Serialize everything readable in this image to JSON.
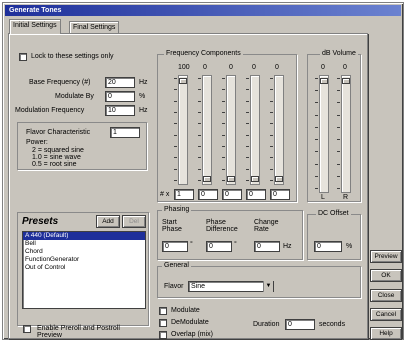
{
  "window": {
    "title": "Generate Tones"
  },
  "tabs": [
    {
      "label": "Initial Settings"
    },
    {
      "label": "Final Settings"
    }
  ],
  "options": {
    "lock_label": "Lock to these settings only"
  },
  "base": {
    "base_freq_label": "Base Frequency (#)",
    "base_freq_value": "20",
    "base_freq_unit": "Hz",
    "modulate_label": "Modulate By",
    "modulate_value": "0",
    "modulate_unit": "%",
    "modfreq_label": "Modulation Frequency",
    "modfreq_value": "10",
    "modfreq_unit": "Hz"
  },
  "flavor": {
    "label": "Flavor Characteristic",
    "value": "1",
    "power_label": "Power:",
    "line1": "2 = squared sine",
    "line2": "1.0 = sine wave",
    "line3": "0.5 = root sine"
  },
  "freq_components": {
    "title": "Frequency Components",
    "top_values": [
      "100",
      "0",
      "0",
      "0",
      "0"
    ],
    "field_label": "# x",
    "values": [
      "1",
      "0",
      "0",
      "0",
      "0"
    ],
    "levels": [
      1.0,
      0.0,
      0.0,
      0.0,
      0.0
    ]
  },
  "volume": {
    "title": "dB Volume",
    "top_values": [
      "0",
      "0"
    ],
    "left_label": "L",
    "right_label": "R",
    "levels": [
      1.0,
      1.0
    ]
  },
  "phasing": {
    "title": "Phasing",
    "start_label_1": "Start",
    "start_label_2": "Phase",
    "start_value": "0",
    "start_unit": "°",
    "diff_label_1": "Phase",
    "diff_label_2": "Difference",
    "diff_value": "0",
    "diff_unit": "°",
    "change_label_1": "Change",
    "change_label_2": "Rate",
    "change_value": "0",
    "change_unit": "Hz"
  },
  "dc_offset": {
    "title": "DC Offset",
    "value": "0",
    "unit": "%"
  },
  "presets": {
    "title": "Presets",
    "add_label": "Add",
    "del_label": "Del",
    "items": [
      "A 440 (Default)",
      "Bell",
      "Chord",
      "FunctionGenerator",
      "Out of Control"
    ],
    "selected_index": 0,
    "enable_label_1": "Enable Preroll and Postroll",
    "enable_label_2": "Preview"
  },
  "general": {
    "title": "General",
    "flavor_label": "Flavor",
    "flavor_value": "Sine"
  },
  "modulation": {
    "fm_label": "Modulate",
    "am_label": "DeModulate",
    "overlap_label": "Overlap (mix)",
    "duration_label": "Duration",
    "duration_value": "0",
    "duration_unit": "seconds"
  },
  "buttons": {
    "preview": "Preview",
    "ok": "OK",
    "close": "Close",
    "cancel": "Cancel",
    "help": "Help"
  }
}
